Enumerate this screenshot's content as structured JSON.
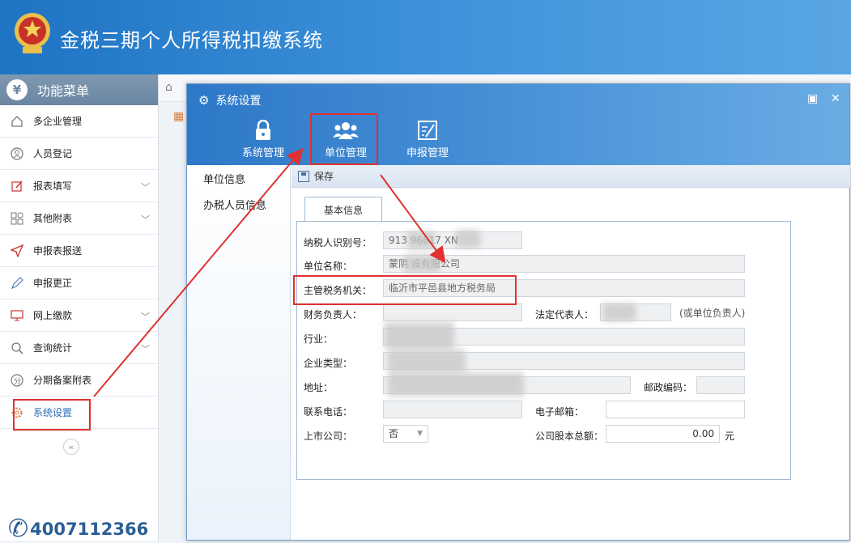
{
  "header": {
    "title": "金税三期个人所得税扣缴系统"
  },
  "sidebar": {
    "title": "功能菜单",
    "items": [
      {
        "label": "多企业管理",
        "icon": "home-icon",
        "expandable": false
      },
      {
        "label": "人员登记",
        "icon": "person-icon",
        "expandable": false
      },
      {
        "label": "报表填写",
        "icon": "edit-icon",
        "expandable": true
      },
      {
        "label": "其他附表",
        "icon": "grid-icon",
        "expandable": true
      },
      {
        "label": "申报表报送",
        "icon": "send-icon",
        "expandable": false
      },
      {
        "label": "申报更正",
        "icon": "pen-icon",
        "expandable": false
      },
      {
        "label": "网上缴款",
        "icon": "monitor-icon",
        "expandable": true
      },
      {
        "label": "查询统计",
        "icon": "search-icon",
        "expandable": true
      },
      {
        "label": "分期备案附表",
        "icon": "split-icon",
        "expandable": false
      },
      {
        "label": "系统设置",
        "icon": "gear-icon",
        "expandable": false,
        "active": true
      }
    ],
    "hotline": "4007112366"
  },
  "dialog": {
    "title": "系统设置",
    "toolbar": [
      {
        "label": "系统管理",
        "icon": "lock-icon"
      },
      {
        "label": "单位管理",
        "icon": "users-icon"
      },
      {
        "label": "申报管理",
        "icon": "report-icon"
      }
    ],
    "leftnav": [
      "单位信息",
      "办税人员信息"
    ],
    "save_label": "保存",
    "tab_label": "基本信息",
    "form": {
      "taxpayer_id_label": "纳税人识别号：",
      "taxpayer_id_value": "913 96817 XN",
      "company_name_label": "单位名称：",
      "company_name_value": "蒙阴 设有限公司",
      "tax_authority_label": "主管税务机关：",
      "tax_authority_value": "临沂市平邑县地方税务局",
      "finance_head_label": "财务负责人：",
      "legal_rep_label": "法定代表人：",
      "legal_rep_note": "(或单位负责人)",
      "industry_label": "行业：",
      "company_type_label": "企业类型：",
      "address_label": "地址：",
      "postcode_label": "邮政编码：",
      "phone_label": "联系电话：",
      "email_label": "电子邮箱：",
      "listed_label": "上市公司：",
      "listed_value": "否",
      "capital_label": "公司股本总额：",
      "capital_value": "0.00",
      "capital_unit": "元"
    }
  },
  "colors": {
    "header_blue": "#1e73c3",
    "annotation_red": "#e03030"
  }
}
